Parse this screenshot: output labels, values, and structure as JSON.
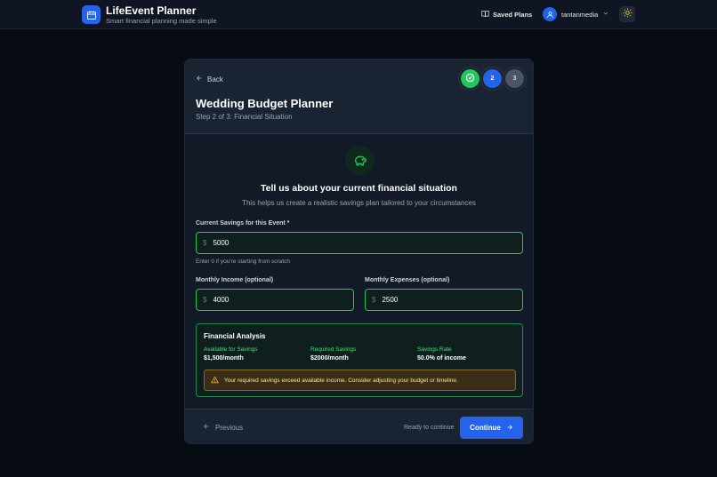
{
  "header": {
    "app_title": "LifeEvent Planner",
    "app_subtitle": "Smart financial planning made simple",
    "saved_plans": "Saved Plans",
    "username": "tantanmedia"
  },
  "card": {
    "back": "Back",
    "title": "Wedding Budget Planner",
    "subtitle": "Step 2 of 3: Financial Situation",
    "steps": [
      "",
      "2",
      "3"
    ],
    "question_title": "Tell us about your current financial situation",
    "question_subtitle": "This helps us create a realistic savings plan tailored to your circumstances"
  },
  "form": {
    "savings_label": "Current Savings for this Event *",
    "savings_value": "5000",
    "savings_help": "Enter 0 if you're starting from scratch",
    "income_label": "Monthly Income (optional)",
    "income_value": "4000",
    "expenses_label": "Monthly Expenses (optional)",
    "expenses_value": "2500",
    "currency": "$"
  },
  "analysis": {
    "title": "Financial Analysis",
    "metrics": [
      {
        "label": "Available for Savings",
        "value": "$1,500/month"
      },
      {
        "label": "Required Savings",
        "value": "$2000/month"
      },
      {
        "label": "Savings Rate",
        "value": "50.0% of income"
      }
    ],
    "warning": "Your required savings exceed available income. Consider adjusting your budget or timeline."
  },
  "footer": {
    "previous": "Previous",
    "status": "Ready to continue",
    "continue": "Continue"
  },
  "colors": {
    "accent": "#2563eb",
    "success": "#22c55e",
    "warning": "#fde68a",
    "background": "#070b14"
  },
  "icons": [
    "calendar-icon",
    "book-icon",
    "user-icon",
    "chevron-down-icon",
    "sun-icon",
    "arrow-left-icon",
    "check-circle-icon",
    "piggy-bank-icon",
    "warning-triangle-icon",
    "arrow-right-icon"
  ]
}
